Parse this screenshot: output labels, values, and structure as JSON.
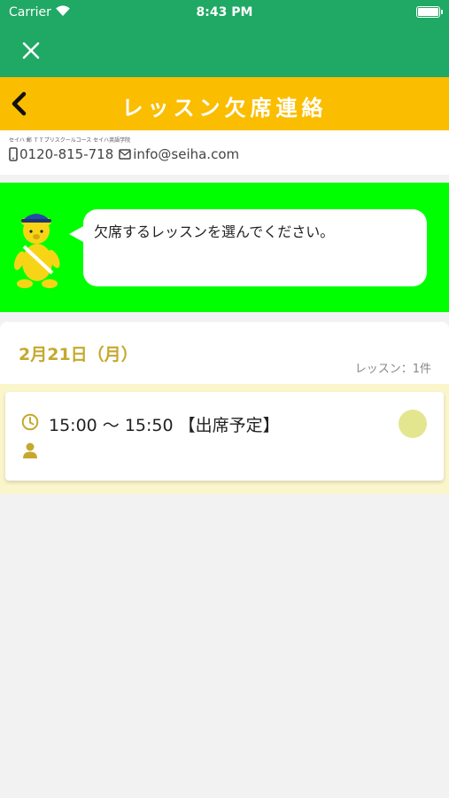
{
  "status_bar": {
    "carrier": "Carrier",
    "time": "8:43 PM"
  },
  "header": {
    "title": "レッスン欠席連絡"
  },
  "school": {
    "name": "セイハ 郵 ＴＴプリスクールコース セイハ英語学院",
    "phone": "0120-815-718",
    "email": "info@seiha.com"
  },
  "banner": {
    "message": "欠席するレッスンを選んでください。"
  },
  "day": {
    "date": "2月21日（月）",
    "count_label": "レッスン：1件"
  },
  "lessons": [
    {
      "time": "15:00 〜 15:50 【出席予定】",
      "teacher": ""
    }
  ],
  "colors": {
    "nav_green": "#20a865",
    "title_yellow": "#fbbd00",
    "banner_green": "#00ff00",
    "date_gold": "#c5a92e",
    "lesson_bg": "#fbf5cb",
    "circle": "#e3e68f"
  }
}
